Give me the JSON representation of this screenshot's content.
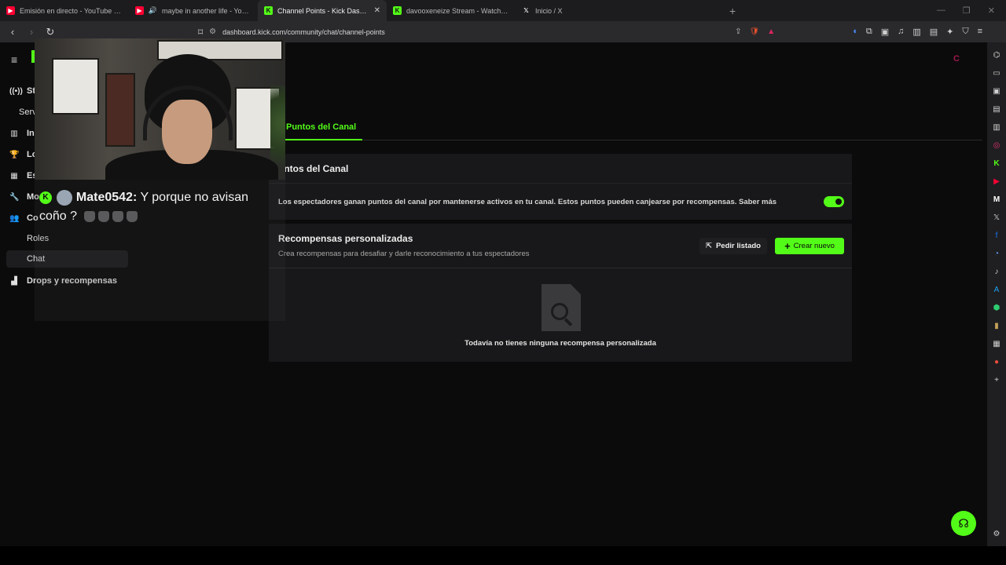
{
  "tabs": [
    {
      "title": "Emisión en directo - YouTube Studio",
      "icon": "youtube-studio-icon",
      "color": "#ff0033",
      "active": false
    },
    {
      "title": "maybe in another life - YouTube",
      "icon": "youtube-icon",
      "color": "#ff0033",
      "active": false
    },
    {
      "title": "Channel Points - Kick Dashboard",
      "icon": "kick-icon",
      "color": "#53fc18",
      "active": true
    },
    {
      "title": "davooxeneize Stream - Watch Live o",
      "icon": "kick-icon",
      "color": "#53fc18",
      "active": false
    },
    {
      "title": "Inicio / X",
      "icon": "x-icon",
      "color": "#ffffff",
      "active": false
    }
  ],
  "address_bar": {
    "url": "dashboard.kick.com/community/chat/channel-points"
  },
  "sidebar": {
    "items": [
      {
        "label": "St",
        "icon": "broadcast-icon"
      },
      {
        "label": "Serv",
        "icon": ""
      },
      {
        "label": "In",
        "icon": "chart-icon"
      },
      {
        "label": "Lo",
        "icon": "trophy-icon"
      },
      {
        "label": "Es",
        "icon": "stats-icon"
      },
      {
        "label": "Mo",
        "icon": "wrench-icon"
      },
      {
        "label": "Co",
        "icon": "users-icon"
      }
    ],
    "roles_label": "Roles",
    "chat_label": "Chat",
    "drops_label": "Drops y recompensas"
  },
  "main": {
    "active_tab": "Puntos del Canal",
    "channel_points": {
      "title": "untos del Canal",
      "description": "Los espectadores ganan puntos del canal por mantenerse activos en tu canal. Estos puntos pueden canjearse por recompensas. Saber más",
      "enabled": true
    },
    "custom_rewards": {
      "title": "Recompensas personalizadas",
      "subtitle": "Crea recompensas para desafiar y darle reconocimiento a tus espectadores",
      "request_list_label": "Pedir listado",
      "create_label": "Crear nuevo",
      "empty_text": "Todavía no tienes ninguna recompensa personalizada"
    }
  },
  "chat_overlay": {
    "username": "Mate0542:",
    "message": "Y porque no avisan coño ?"
  },
  "colors": {
    "accent": "#53fc18",
    "background": "#0b0b0c",
    "panel": "#18181a"
  }
}
